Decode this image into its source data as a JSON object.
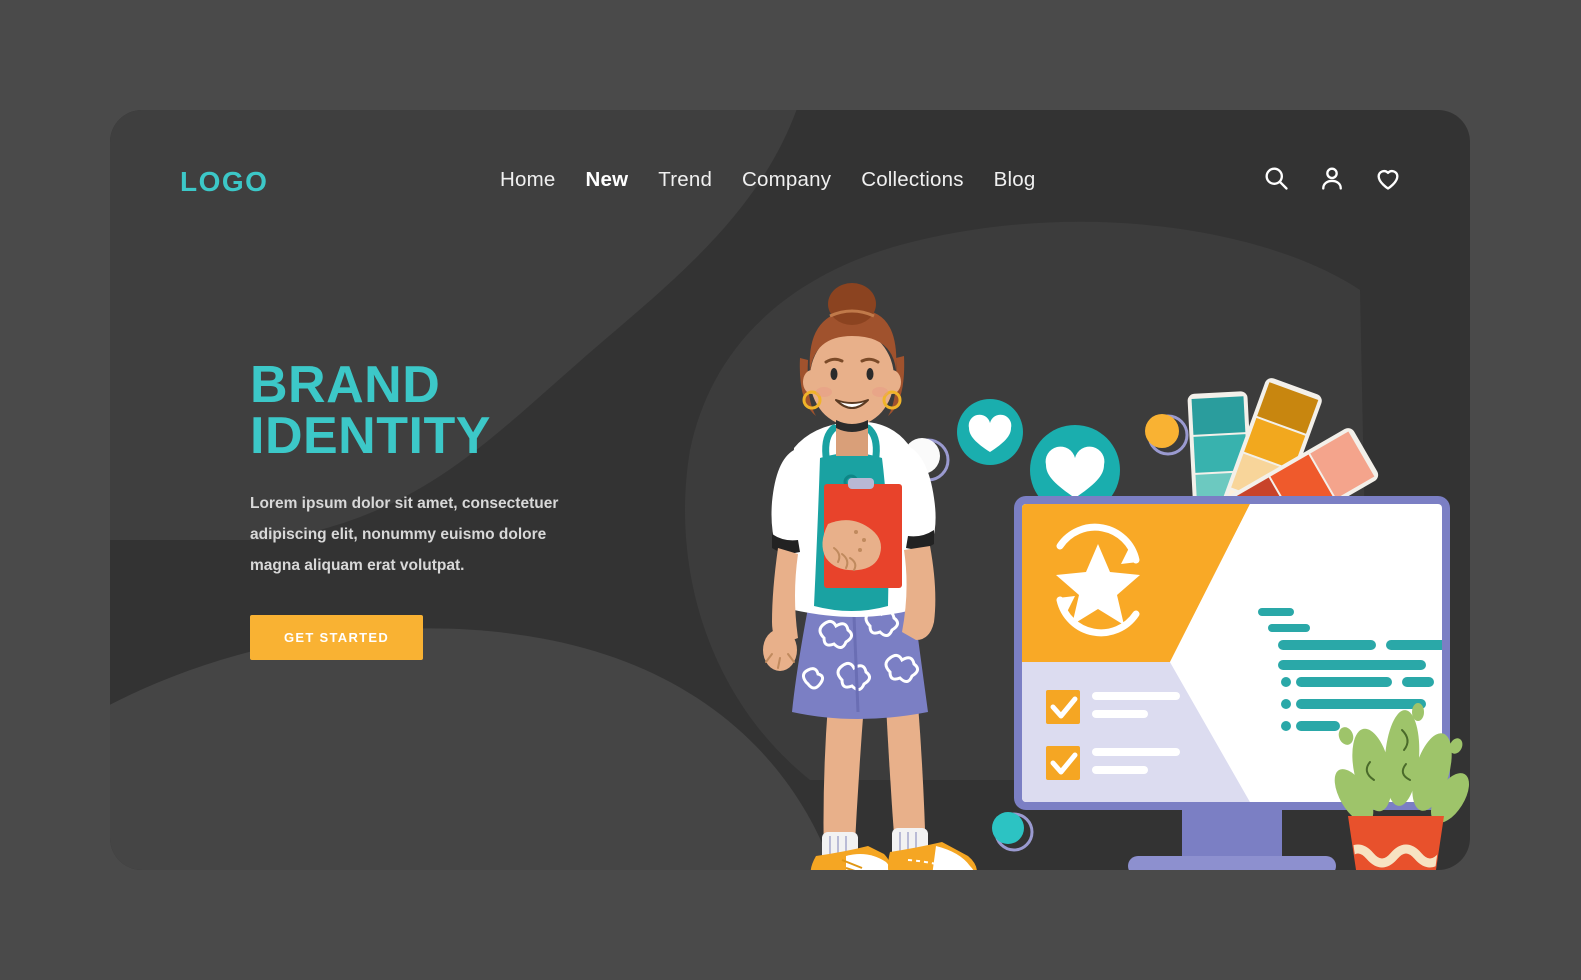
{
  "page": {
    "background_color": "#4a4a4a",
    "card_color": "#333333",
    "accent_teal": "#3cc8c8",
    "accent_orange": "#f9b233",
    "text_light": "#f0f0f0"
  },
  "header": {
    "logo": "LOGO",
    "nav": [
      {
        "label": "Home",
        "active": false
      },
      {
        "label": "New",
        "active": true
      },
      {
        "label": "Trend",
        "active": false
      },
      {
        "label": "Company",
        "active": false
      },
      {
        "label": "Collections",
        "active": false
      },
      {
        "label": "Blog",
        "active": false
      }
    ],
    "icons": [
      {
        "name": "search-icon",
        "label": "Search"
      },
      {
        "name": "user-icon",
        "label": "Account"
      },
      {
        "name": "heart-icon",
        "label": "Favorites"
      }
    ]
  },
  "hero": {
    "headline": "BRAND\nIDENTITY",
    "subcopy": "Lorem ipsum dolor sit amet, consectetuer adipiscing elit, nonummy euismo dolore magna aliquam erat volutpat.",
    "cta_label": "GET STARTED"
  },
  "illustration": {
    "description": "Woman with clipboard standing beside a desktop monitor showing a brand-identity dashboard, surrounded by heart badges, color swatch fan and a potted plant",
    "character": {
      "hair_color": "#a0522d",
      "skin_color": "#e8b08a",
      "shirt_color": "#ffffff",
      "apron_color": "#1aa2a2",
      "skirt_color": "#7b7fc4",
      "clipboard_color": "#e8432b",
      "shoe_color": "#f5a623"
    },
    "monitor": {
      "frame_color": "#7b7fc4",
      "screen_color": "#ffffff",
      "panel_color": "#f9a926",
      "sidebar_color": "#dcdcf0",
      "star_icon": "star-refresh-icon",
      "checklist_items": 2,
      "checkbox_color": "#f5a623",
      "code_line_color": "#2aa8a8",
      "code_line_count": 9
    },
    "badges": [
      {
        "name": "heart-badge-small",
        "color": "#1aaeae",
        "size": 62
      },
      {
        "name": "heart-badge-large",
        "color": "#1aaeae",
        "size": 86
      },
      {
        "name": "bubble-white",
        "color": "#ffffff",
        "size": 34
      },
      {
        "name": "bubble-orange",
        "color": "#f9b233",
        "size": 32
      },
      {
        "name": "bubble-teal",
        "color": "#2cc3c3",
        "size": 30
      }
    ],
    "swatches": [
      {
        "name": "swatch-card-teal",
        "colors": [
          "#2a9d9d",
          "#38b2ae",
          "#6cc9c0",
          "#cfeae4"
        ]
      },
      {
        "name": "swatch-card-orange",
        "colors": [
          "#c8860f",
          "#f2a81e",
          "#f8d59a",
          "#fdf0dc"
        ]
      },
      {
        "name": "swatch-card-red",
        "colors": [
          "#f4a48c",
          "#ef5a2c",
          "#c8432a"
        ]
      }
    ],
    "plant": {
      "name": "potted-plant",
      "leaf_color": "#9ec46a",
      "pot_color": "#e8512c",
      "pot_stripe_color": "#f7e3c2"
    }
  }
}
